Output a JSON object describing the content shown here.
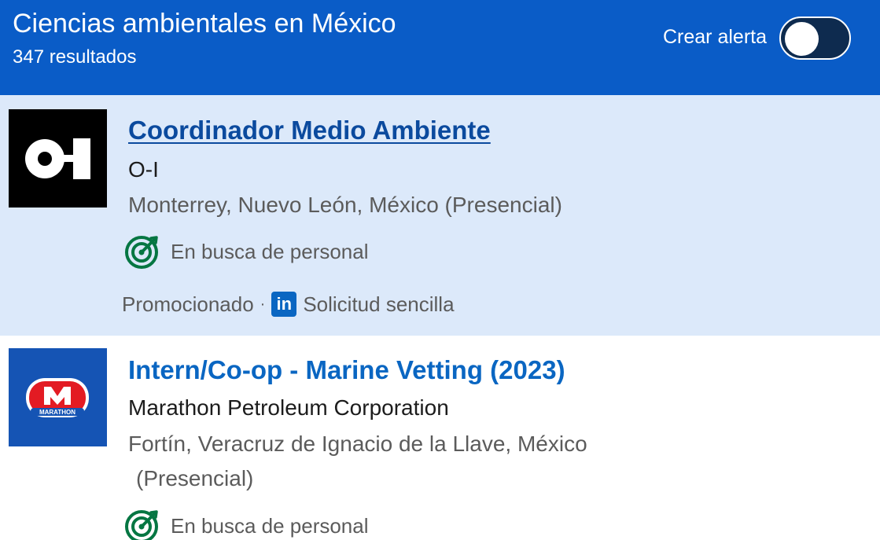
{
  "header": {
    "title": "Ciencias ambientales en México",
    "result_count": "347 resultados",
    "alert_label": "Crear alerta",
    "alert_enabled": false
  },
  "jobs": [
    {
      "title": "Coordinador Medio Ambiente",
      "company": "O-I",
      "location": "Monterrey, Nuevo León, México (Presencial)",
      "hiring_status": "En busca de personal",
      "promoted": "Promocionado",
      "separator": "·",
      "apply_type": "Solicitud sencilla",
      "logo": {
        "text": "O-I",
        "background": "#000000"
      }
    },
    {
      "title": "Intern/Co-op - Marine Vetting (2023)",
      "company": "Marathon Petroleum Corporation",
      "location_line1": "Fortín, Veracruz de Ignacio de la Llave, México",
      "location_line2": "(Presencial)",
      "hiring_status": "En busca de personal",
      "logo": {
        "text": "MARATHON",
        "background": "#1554b4"
      }
    }
  ],
  "icons": {
    "hiring": "target-icon",
    "linkedin": "linkedin-icon"
  },
  "colors": {
    "header_bg": "#0a5cc7",
    "selected_card_bg": "#dce9fa",
    "link": "#0a66c2",
    "hiring_green": "#057642"
  }
}
